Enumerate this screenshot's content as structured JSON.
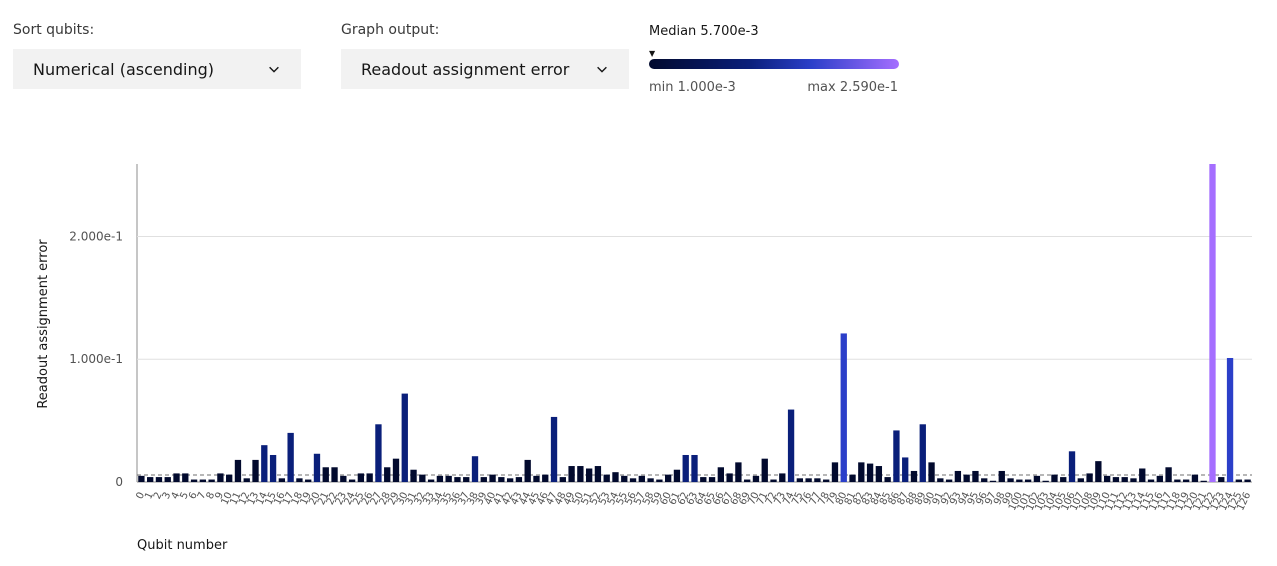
{
  "controls": {
    "sort_label": "Sort qubits:",
    "sort_value": "Numerical (ascending)",
    "output_label": "Graph output:",
    "output_value": "Readout assignment error"
  },
  "legend": {
    "median": "Median 5.700e-3",
    "min": "min 1.000e-3",
    "max": "max 2.590e-1",
    "marker": "▼"
  },
  "icons": {
    "dropdown": "chevron-down-icon"
  },
  "colors": {
    "low": "#020a2e",
    "mid": "#0a1f7a",
    "high": "#2b3fc9",
    "max": "#a56eff",
    "median_line": "#6f6f6f"
  },
  "chart_data": {
    "type": "bar",
    "title": "",
    "xlabel": "Qubit number",
    "ylabel": "Readout assignment error",
    "ylim": [
      0,
      0.259
    ],
    "y_ticks": [
      0,
      0.1,
      0.2
    ],
    "y_tick_labels": [
      "0",
      "1.000e-1",
      "2.000e-1"
    ],
    "median": 0.0057,
    "min": 0.001,
    "max": 0.259,
    "categories": [
      "0",
      "1",
      "2",
      "3",
      "4",
      "5",
      "6",
      "7",
      "8",
      "9",
      "10",
      "11",
      "12",
      "13",
      "14",
      "15",
      "16",
      "17",
      "18",
      "19",
      "20",
      "21",
      "22",
      "23",
      "24",
      "25",
      "26",
      "27",
      "28",
      "29",
      "30",
      "31",
      "32",
      "33",
      "34",
      "35",
      "36",
      "37",
      "38",
      "39",
      "40",
      "41",
      "42",
      "43",
      "44",
      "45",
      "46",
      "47",
      "48",
      "49",
      "50",
      "51",
      "52",
      "53",
      "54",
      "55",
      "56",
      "57",
      "58",
      "59",
      "60",
      "61",
      "62",
      "63",
      "64",
      "65",
      "66",
      "67",
      "68",
      "69",
      "70",
      "71",
      "72",
      "73",
      "74",
      "75",
      "76",
      "77",
      "78",
      "79",
      "80",
      "81",
      "82",
      "83",
      "84",
      "85",
      "86",
      "87",
      "88",
      "89",
      "90",
      "91",
      "92",
      "93",
      "94",
      "95",
      "96",
      "97",
      "98",
      "99",
      "100",
      "101",
      "102",
      "103",
      "104",
      "105",
      "106",
      "107",
      "108",
      "109",
      "110",
      "111",
      "112",
      "113",
      "114",
      "115",
      "116",
      "117",
      "118",
      "119",
      "120",
      "121",
      "122",
      "123",
      "124",
      "125",
      "126"
    ],
    "values": [
      0.005,
      0.004,
      0.004,
      0.004,
      0.007,
      0.007,
      0.002,
      0.002,
      0.002,
      0.007,
      0.006,
      0.018,
      0.003,
      0.018,
      0.03,
      0.022,
      0.003,
      0.04,
      0.003,
      0.002,
      0.023,
      0.012,
      0.012,
      0.005,
      0.002,
      0.007,
      0.007,
      0.047,
      0.012,
      0.019,
      0.072,
      0.01,
      0.006,
      0.002,
      0.005,
      0.005,
      0.004,
      0.004,
      0.021,
      0.004,
      0.006,
      0.004,
      0.003,
      0.004,
      0.018,
      0.005,
      0.006,
      0.053,
      0.004,
      0.013,
      0.013,
      0.011,
      0.013,
      0.006,
      0.008,
      0.005,
      0.003,
      0.005,
      0.003,
      0.002,
      0.006,
      0.01,
      0.022,
      0.022,
      0.004,
      0.004,
      0.012,
      0.007,
      0.016,
      0.002,
      0.005,
      0.019,
      0.002,
      0.007,
      0.059,
      0.003,
      0.003,
      0.003,
      0.002,
      0.016,
      0.121,
      0.006,
      0.016,
      0.015,
      0.013,
      0.004,
      0.042,
      0.02,
      0.009,
      0.047,
      0.016,
      0.003,
      0.002,
      0.009,
      0.006,
      0.009,
      0.003,
      0.001,
      0.009,
      0.003,
      0.002,
      0.002,
      0.005,
      0.001,
      0.006,
      0.004,
      0.025,
      0.003,
      0.007,
      0.017,
      0.005,
      0.004,
      0.004,
      0.003,
      0.011,
      0.002,
      0.005,
      0.012,
      0.002,
      0.002,
      0.006,
      0.001,
      0.259,
      0.004,
      0.101,
      0.002,
      0.002
    ]
  }
}
